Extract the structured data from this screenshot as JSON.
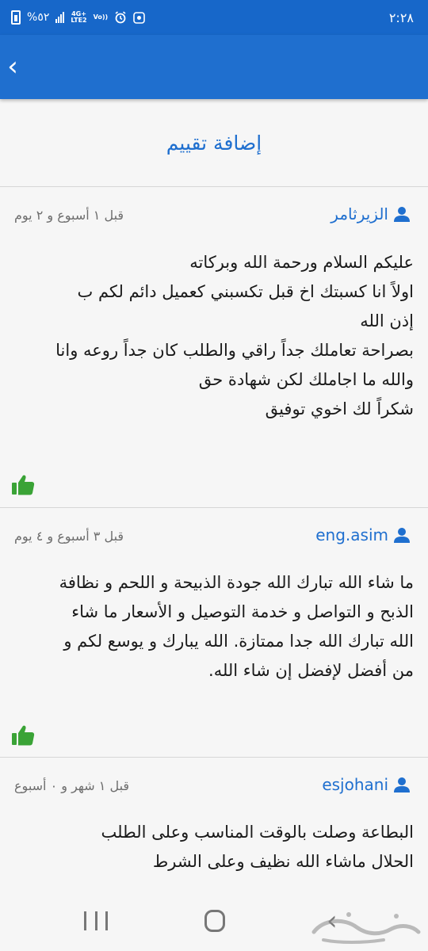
{
  "status_bar": {
    "battery_text": "%٥٢",
    "network_top": "4G+",
    "network_bottom": "LTE2",
    "volte": "Vo))",
    "time": "٢:٢٨"
  },
  "header": {
    "back_glyph": "‹"
  },
  "add_review_label": "إضافة تقييم",
  "reviews": [
    {
      "author": "الزيرثامر",
      "date": "قبل ١ أسبوع و ٢ يوم",
      "text": "عليكم السلام ورحمة الله وبركاته\nاولاً انا كسبتك اخ قبل تكسبني كعميل دائم لكم ب\nإذن الله\nبصراحة تعاملك جداً راقي والطلب كان جداً روعه وانا\nوالله ما اجاملك لكن شهادة حق\nشكراً لك اخوي توفيق"
    },
    {
      "author": "eng.asim",
      "date": "قبل ٣ أسبوع و ٤ يوم",
      "text": "ما شاء الله تبارك الله جودة الذبيحة و اللحم و نظافة\nالذبح و التواصل و خدمة التوصيل و الأسعار ما شاء\nالله تبارك الله جدا ممتازة. الله يبارك و يوسع لكم و\nمن أفضل لإفضل إن شاء الله."
    },
    {
      "author": "esjohani",
      "date": "قبل ١ شهر و ٠ أسبوع",
      "text": "البطاعة وصلت بالوقت المناسب وعلى الطلب\nالحلال ماشاء الله نظيف وعلى الشرط"
    }
  ],
  "colors": {
    "primary": "#1f6fcf",
    "status_bar": "#1767c9",
    "like_green": "#3aa336",
    "divider": "#d6d6d6"
  },
  "icons": {
    "user": "user-icon",
    "like": "thumbs-up-icon",
    "back": "chevron-left-icon"
  }
}
